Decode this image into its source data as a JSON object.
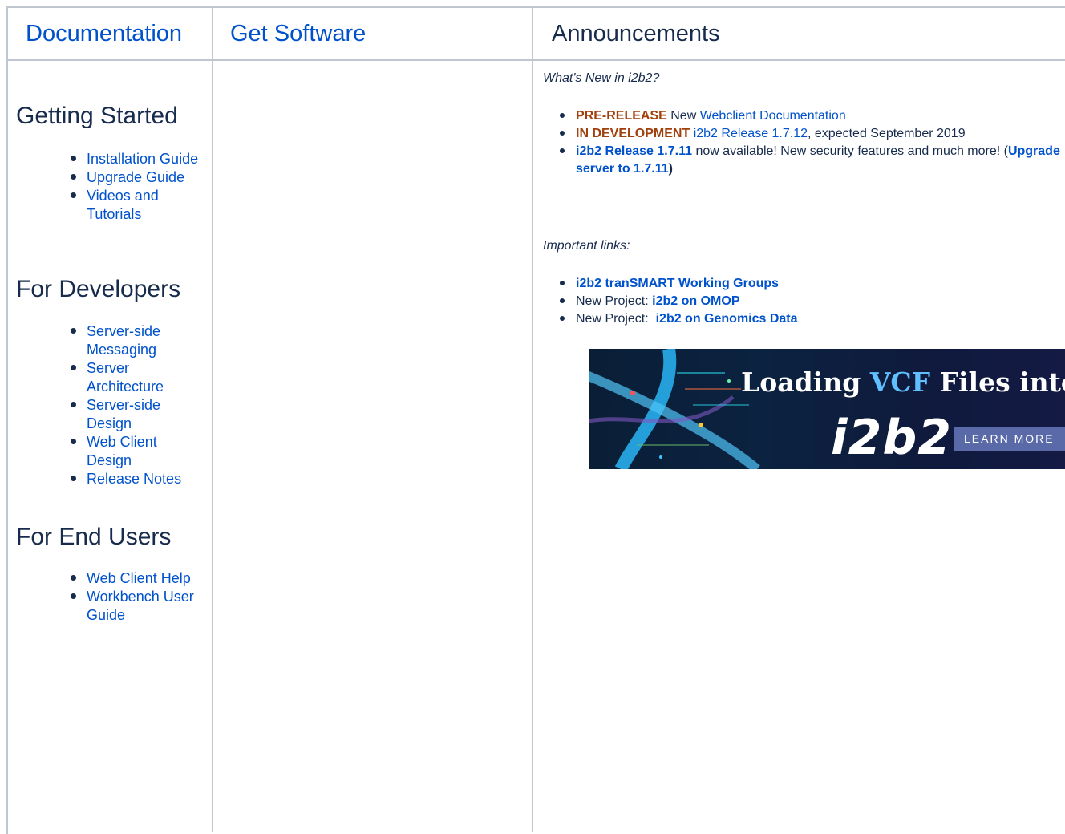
{
  "header": {
    "documentation": "Documentation",
    "get_software": "Get Software",
    "announcements": "Announcements"
  },
  "sidebar": {
    "getting_started": {
      "title": "Getting Started",
      "items": [
        "Installation Guide",
        "Upgrade Guide",
        "Videos and Tutorials"
      ]
    },
    "for_developers": {
      "title": "For Developers",
      "items": [
        "Server-side Messaging",
        "Server Architecture",
        "Server-side Design",
        "Web Client Design",
        "Release Notes"
      ]
    },
    "for_end_users": {
      "title": "For End Users",
      "items": [
        "Web Client Help",
        "Workbench User Guide"
      ]
    }
  },
  "announcements": {
    "whats_new": "What's New in i2b2?",
    "news": [
      {
        "tag": "PRE-RELEASE",
        "text": " New ",
        "link": "Webclient Documentation",
        "rest": ""
      },
      {
        "tag": "IN DEVELOPMENT",
        "text": " ",
        "link": "i2b2 Release 1.7.12",
        "rest": ", expected September 2019"
      },
      {
        "link": "i2b2 Release 1.7.11",
        "text": " now available! New security features and much more! (",
        "link2": "Upgrade server to 1.7.11",
        "close": ")"
      }
    ],
    "important_links_label": "Important links:",
    "important": [
      {
        "prefix": "",
        "link": "i2b2 tranSMART Working Groups"
      },
      {
        "prefix": "New Project: ",
        "link": "i2b2 on OMOP"
      },
      {
        "prefix": "New Project:  ",
        "link": "i2b2 on Genomics Data"
      }
    ],
    "banner": {
      "line1_a": "Loading ",
      "line1_b": "VCF",
      "line1_c": " Files into",
      "line2": "i2b2",
      "button": "LEARN MORE"
    }
  }
}
